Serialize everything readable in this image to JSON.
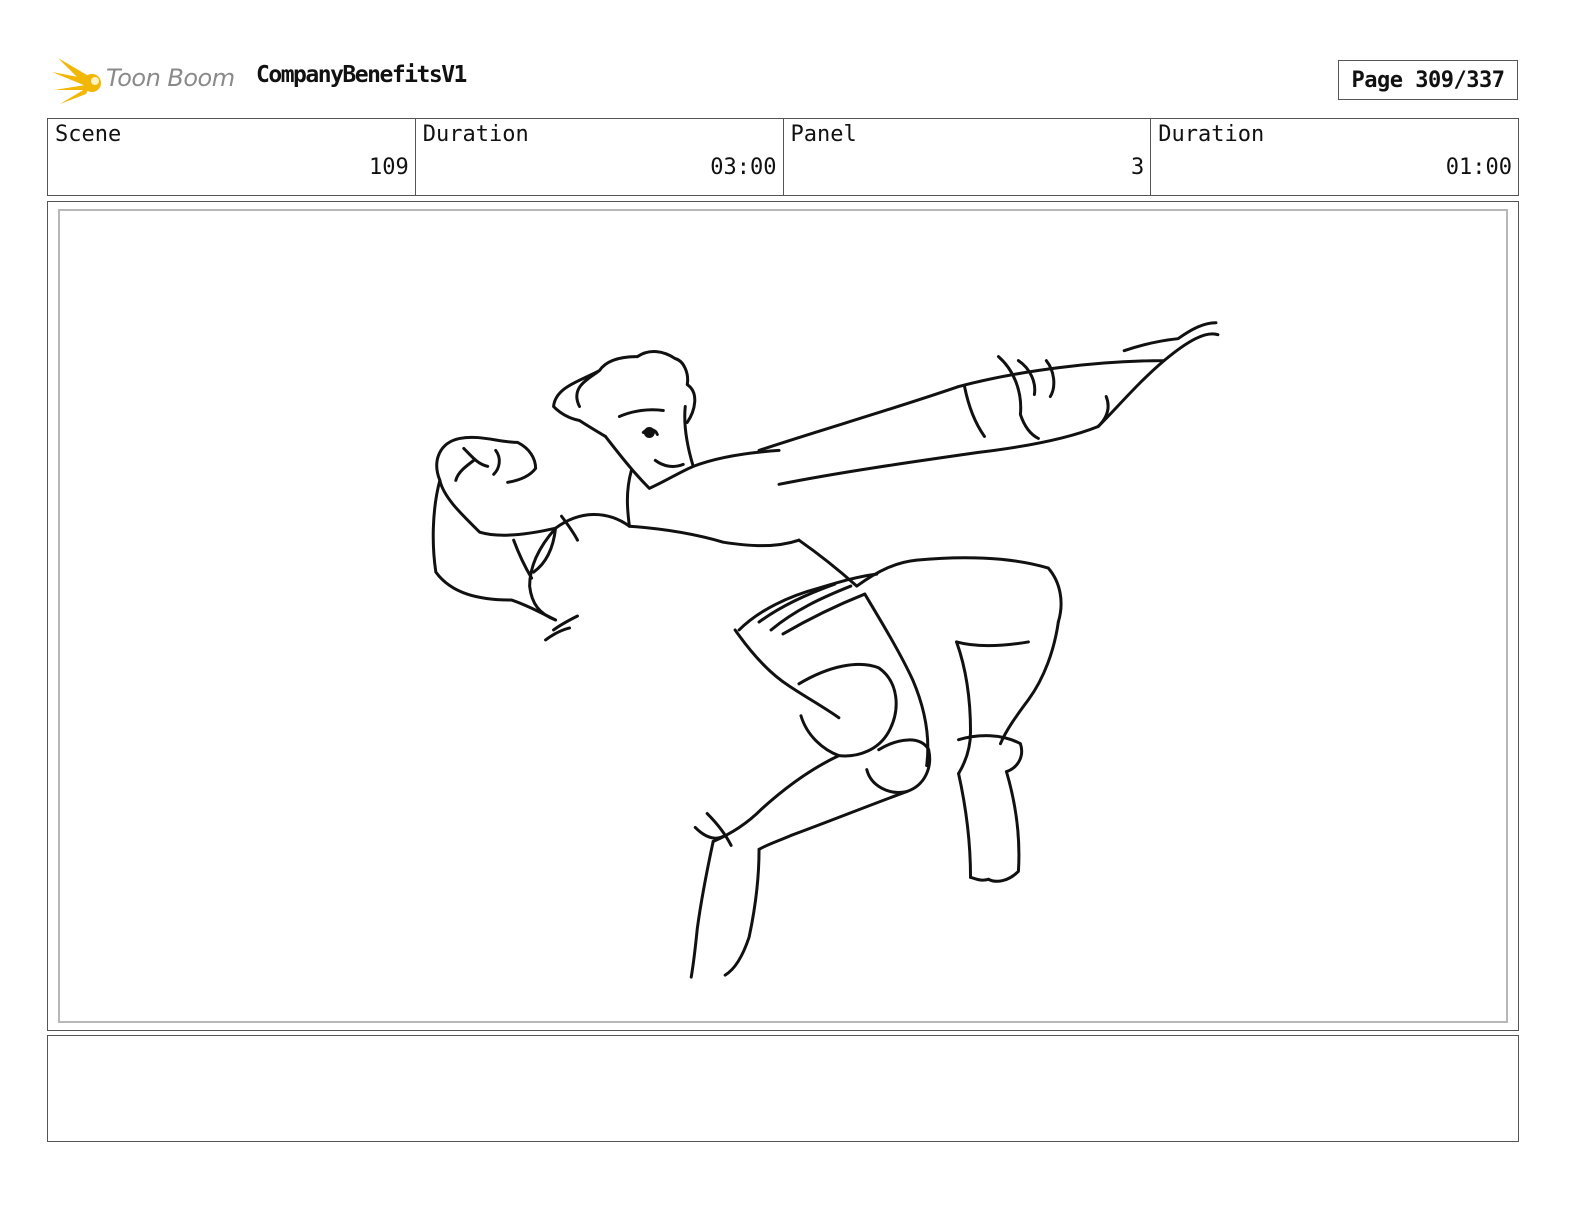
{
  "header": {
    "logo_text": "Toon Boom",
    "project_title": "CompanyBenefitsV1",
    "page_indicator": "Page 309/337"
  },
  "info": {
    "scene_label": "Scene",
    "scene_value": "109",
    "scene_duration_label": "Duration",
    "scene_duration_value": "03:00",
    "panel_label": "Panel",
    "panel_value": "3",
    "panel_duration_label": "Duration",
    "panel_duration_value": "01:00"
  },
  "panel": {
    "image_description": "rough storyboard sketch of a character leaping through the air with one arm extended",
    "sketch_icon": "character-sketch-icon"
  },
  "notes": {
    "text": ""
  },
  "colors": {
    "logo_burst": "#f2b705",
    "logo_text": "#8a8a8a",
    "frame_border": "#555555",
    "inner_border": "#b8b8b8"
  }
}
